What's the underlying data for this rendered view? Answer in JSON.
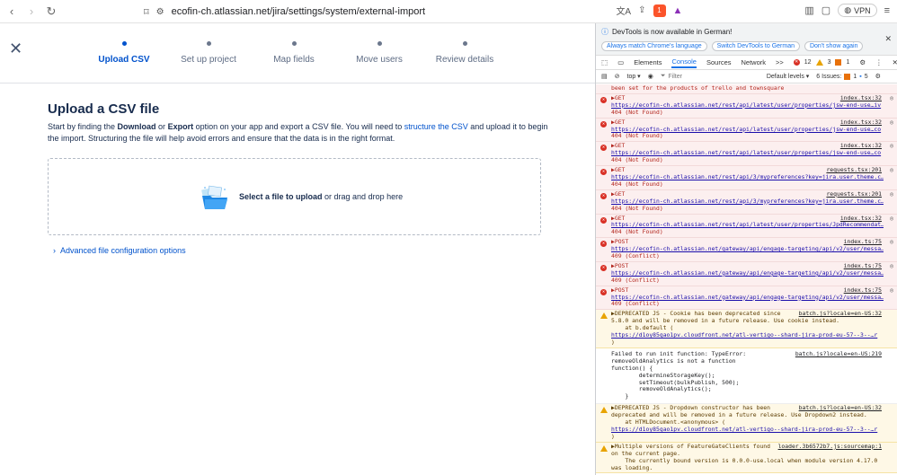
{
  "browser": {
    "url": "ecofin-ch.atlassian.net/jira/settings/system/external-import",
    "vpn_label": "VPN",
    "brave_badge": "1"
  },
  "stepper": {
    "steps": [
      {
        "label": "Upload CSV",
        "active": true
      },
      {
        "label": "Set up project",
        "active": false
      },
      {
        "label": "Map fields",
        "active": false
      },
      {
        "label": "Move users",
        "active": false
      },
      {
        "label": "Review details",
        "active": false
      }
    ]
  },
  "main": {
    "heading": "Upload a CSV file",
    "desc_part1": "Start by finding the ",
    "desc_download": "Download",
    "desc_or": " or ",
    "desc_export": "Export",
    "desc_part2": " option on your app and export a CSV file. You will need to ",
    "desc_link": "structure the CSV",
    "desc_part3": " and upload it to begin the import. Structuring the file will help avoid errors and ensure that the data is in the right format.",
    "drop_bold": "Select a file to upload",
    "drop_rest": " or drag and drop here",
    "advanced": "Advanced file configuration options"
  },
  "devtools": {
    "notice": "DevTools is now available in German!",
    "btn_match": "Always match Chrome's language",
    "btn_switch": "Switch DevTools to German",
    "btn_dont": "Don't show again",
    "tabs": [
      "Elements",
      "Console",
      "Sources",
      "Network"
    ],
    "more": ">>",
    "err_count": "12",
    "warn_count": "3",
    "info_count": "1",
    "context": "top ▾",
    "filter_placeholder": "Filter",
    "levels": "Default levels ▾",
    "issues_label": "6 Issues:",
    "issues_err": "1",
    "issues_info": "5",
    "top_text": "been set for the products of trello and townsquare",
    "logs": [
      {
        "type": "err",
        "method": "▶GET",
        "src": "index.tsx:32",
        "url": "https://ecofin-ch.atlassian.net/rest/api/latest/user/properties/jsw-end-use…iv",
        "status": "404 (Not Found)"
      },
      {
        "type": "err",
        "method": "▶GET",
        "src": "index.tsx:32",
        "url": "https://ecofin-ch.atlassian.net/rest/api/latest/user/properties/jsw-end-use…co",
        "status": "404 (Not Found)"
      },
      {
        "type": "err",
        "method": "▶GET",
        "src": "index.tsx:32",
        "url": "https://ecofin-ch.atlassian.net/rest/api/latest/user/properties/jsw-end-use…co",
        "status": "404 (Not Found)"
      },
      {
        "type": "err",
        "method": "▶GET",
        "src": "requests.tsx:201",
        "url": "https://ecofin-ch.atlassian.net/rest/api/3/mypreferences?key=jira.user.theme.c…",
        "status": "404 (Not Found)"
      },
      {
        "type": "err",
        "method": "▶GET",
        "src": "requests.tsx:201",
        "url": "https://ecofin-ch.atlassian.net/rest/api/3/mypreferences?key=jira.user.theme.c…",
        "status": "404 (Not Found)"
      },
      {
        "type": "err",
        "method": "▶GET",
        "src": "index.tsx:32",
        "url": "https://ecofin-ch.atlassian.net/rest/api/latest/user/properties/JpdRecommendat…",
        "status": "404 (Not Found)"
      },
      {
        "type": "err",
        "method": "▶POST",
        "src": "index.ts:75",
        "url": "https://ecofin-ch.atlassian.net/gateway/api/engage-targeting/api/v2/user/messa…",
        "status": "409 (Conflict)"
      },
      {
        "type": "err",
        "method": "▶POST",
        "src": "index.ts:75",
        "url": "https://ecofin-ch.atlassian.net/gateway/api/engage-targeting/api/v2/user/messa…",
        "status": "409 (Conflict)"
      },
      {
        "type": "err",
        "method": "▶POST",
        "src": "index.ts:75",
        "url": "https://ecofin-ch.atlassian.net/gateway/api/engage-targeting/api/v2/user/messa…",
        "status": "409 (Conflict)"
      }
    ],
    "warn1": {
      "src": "batch.js?locale=en-US:32",
      "lines": [
        "▶DEPRECATED JS - Cookie has been deprecated since",
        "5.8.0 and will be removed in a future release. Use cookie instead.",
        "    at b.default ("
      ],
      "url": "https://d1oy85gao1pv.cloudfront.net/atl-vertigo--shard-jira-prod-eu-57--3--…r",
      "tail": ")"
    },
    "plain1": {
      "src": "batch.js?locale=en-US:219",
      "lines": [
        "Failed to run init function: TypeError:",
        "removeOldAnalytics is not a function",
        "function() {",
        "        determineStorageKey();",
        "        setTimeout(bulkPublish, 500);",
        "        removeOldAnalytics();",
        "    }"
      ]
    },
    "warn2": {
      "src": "batch.js?locale=en-US:32",
      "lines": [
        "▶DEPRECATED JS - Dropdown constructor has been",
        "deprecated and will be removed in a future release. Use Dropdown2 instead.",
        "    at HTMLDocument.<anonymous> ("
      ],
      "url": "https://d1oy85gao1pv.cloudfront.net/atl-vertigo--shard-jira-prod-eu-57--3--…r",
      "tail": ")"
    },
    "warn3": {
      "src": "loader.3b6572b7.js:sourcemap:1",
      "lines": [
        "▶Multiple versions of FeatureGateClients found",
        "on the current page.",
        "    The currently bound version is 0.0.0-use.local when module version 4.17.0",
        "was loading."
      ]
    }
  }
}
